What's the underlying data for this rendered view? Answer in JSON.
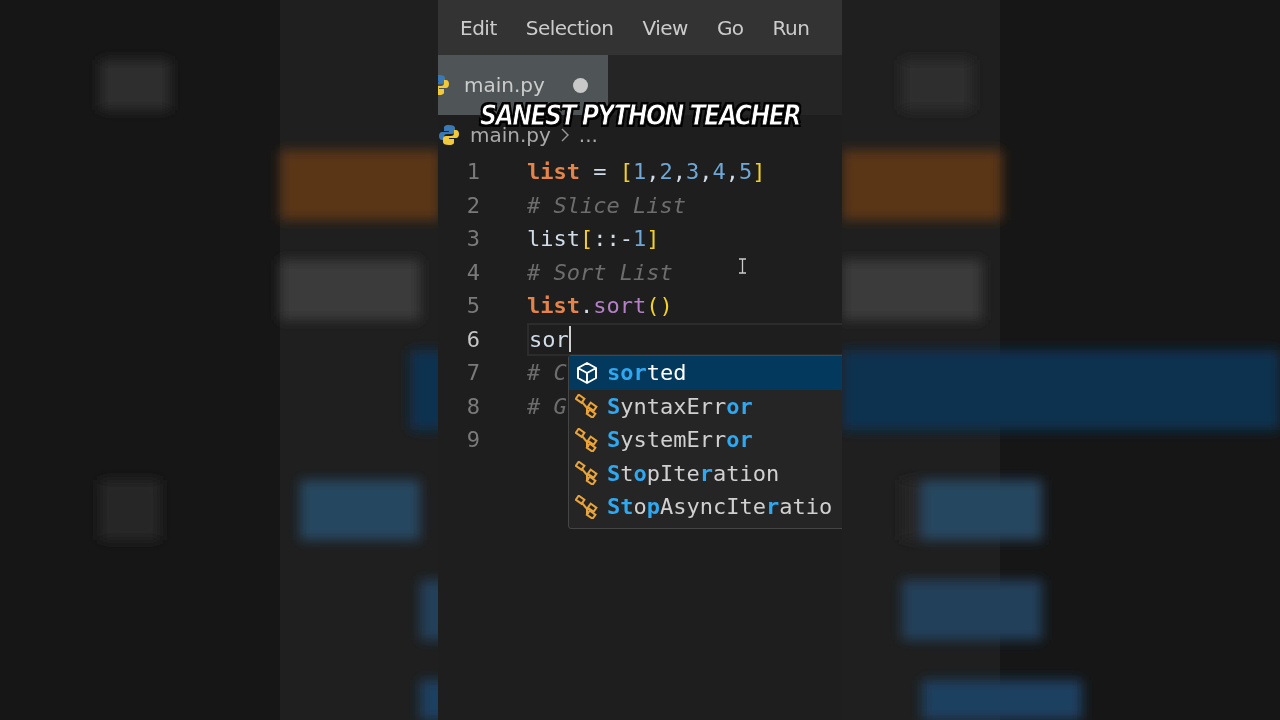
{
  "menu": [
    "Edit",
    "Selection",
    "View",
    "Go",
    "Run"
  ],
  "tabs": [
    {
      "label": "main.py",
      "selected": true,
      "modified": true
    }
  ],
  "breadcrumb": [
    "main.py",
    "..."
  ],
  "caption": "SANEST PYTHON TEACHER",
  "lines": [
    {
      "number": "1",
      "current": false,
      "tokens": [
        {
          "kind": "var",
          "text": "list"
        },
        {
          "kind": "plain",
          "text": " = "
        },
        {
          "kind": "bracket",
          "text": "["
        },
        {
          "kind": "number",
          "text": "1"
        },
        {
          "kind": "plain",
          "text": ","
        },
        {
          "kind": "number",
          "text": "2"
        },
        {
          "kind": "plain",
          "text": ","
        },
        {
          "kind": "number",
          "text": "3"
        },
        {
          "kind": "plain",
          "text": ","
        },
        {
          "kind": "number",
          "text": "4"
        },
        {
          "kind": "plain",
          "text": ","
        },
        {
          "kind": "number",
          "text": "5"
        },
        {
          "kind": "bracket",
          "text": "]"
        }
      ]
    },
    {
      "number": "2",
      "current": false,
      "tokens": [
        {
          "kind": "comment",
          "text": "# Slice List"
        }
      ]
    },
    {
      "number": "3",
      "current": false,
      "tokens": [
        {
          "kind": "plain",
          "text": "list"
        },
        {
          "kind": "bracket",
          "text": "["
        },
        {
          "kind": "plain",
          "text": "::-"
        },
        {
          "kind": "number",
          "text": "1"
        },
        {
          "kind": "bracket",
          "text": "]"
        }
      ]
    },
    {
      "number": "4",
      "current": false,
      "tokens": [
        {
          "kind": "comment",
          "text": "# Sort List"
        }
      ]
    },
    {
      "number": "5",
      "current": false,
      "tokens": [
        {
          "kind": "var",
          "text": "list"
        },
        {
          "kind": "plain",
          "text": "."
        },
        {
          "kind": "method",
          "text": "sort"
        },
        {
          "kind": "bracket",
          "text": "()"
        }
      ]
    },
    {
      "number": "6",
      "current": true,
      "tokens": [
        {
          "kind": "plain",
          "text": "sor"
        }
      ]
    },
    {
      "number": "7",
      "current": false,
      "tokens": [
        {
          "kind": "comment",
          "text": "# C"
        }
      ]
    },
    {
      "number": "8",
      "current": false,
      "tokens": [
        {
          "kind": "comment",
          "text": "# G"
        }
      ]
    },
    {
      "number": "9",
      "current": false
    }
  ],
  "suggestions": [
    {
      "kind": "function",
      "selected": true,
      "parts": [
        {
          "text": "sor",
          "match": true
        },
        {
          "text": "ted",
          "match": false
        }
      ]
    },
    {
      "kind": "class",
      "selected": false,
      "parts": [
        {
          "text": "S",
          "match": true
        },
        {
          "text": "yntaxErr",
          "match": false
        },
        {
          "text": "or",
          "match": true
        }
      ]
    },
    {
      "kind": "class",
      "selected": false,
      "parts": [
        {
          "text": "S",
          "match": true
        },
        {
          "text": "ystemErr",
          "match": false
        },
        {
          "text": "or",
          "match": true
        }
      ]
    },
    {
      "kind": "class",
      "selected": false,
      "parts": [
        {
          "text": "S",
          "match": true
        },
        {
          "text": "t",
          "match": false
        },
        {
          "text": "o",
          "match": true
        },
        {
          "text": "pIte",
          "match": false
        },
        {
          "text": "r",
          "match": true
        },
        {
          "text": "ation",
          "match": false
        }
      ]
    },
    {
      "kind": "class",
      "selected": false,
      "parts": [
        {
          "text": "St",
          "match": true
        },
        {
          "text": "o",
          "match": false
        },
        {
          "text": "p",
          "match": true
        },
        {
          "text": "AsyncIte",
          "match": false
        },
        {
          "text": "r",
          "match": true
        },
        {
          "text": "atio",
          "match": false
        }
      ]
    }
  ]
}
